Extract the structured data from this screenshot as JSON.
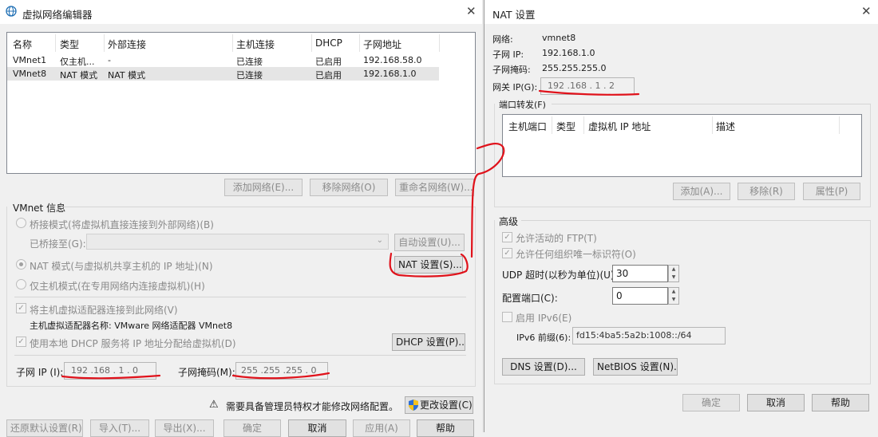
{
  "left": {
    "title": "虚拟网络编辑器",
    "table": {
      "headers": [
        "名称",
        "类型",
        "外部连接",
        "主机连接",
        "DHCP",
        "子网地址"
      ],
      "rows": [
        [
          "VMnet1",
          "仅主机...",
          "-",
          "已连接",
          "已启用",
          "192.168.58.0"
        ],
        [
          "VMnet8",
          "NAT 模式",
          "NAT 模式",
          "已连接",
          "已启用",
          "192.168.1.0"
        ]
      ]
    },
    "add_network": "添加网络(E)...",
    "remove_network": "移除网络(O)",
    "rename_network": "重命名网络(W)...",
    "vmnet_info": "VMnet 信息",
    "bridge_mode": "桥接模式(将虚拟机直接连接到外部网络)(B)",
    "bridged_to": "已桥接至(G):",
    "auto_settings": "自动设置(U)...",
    "nat_mode": "NAT 模式(与虚拟机共享主机的 IP 地址)(N)",
    "nat_settings": "NAT 设置(S)...",
    "host_only_mode": "仅主机模式(在专用网络内连接虚拟机)(H)",
    "connect_adapter": "将主机虚拟适配器连接到此网络(V)",
    "adapter_name": "主机虚拟适配器名称: VMware 网络适配器 VMnet8",
    "use_dhcp": "使用本地 DHCP 服务将 IP 地址分配给虚拟机(D)",
    "dhcp_settings": "DHCP 设置(P)...",
    "subnet_ip_label": "子网 IP (I):",
    "subnet_ip": "192 .168 . 1 . 0",
    "subnet_mask_label": "子网掩码(M):",
    "subnet_mask": "255 .255 .255 . 0",
    "admin_notice": "需要具备管理员特权才能修改网络配置。",
    "change_settings": "更改设置(C)",
    "restore_defaults": "还原默认设置(R)",
    "import": "导入(T)...",
    "export": "导出(X)...",
    "ok": "确定",
    "cancel": "取消",
    "apply": "应用(A)",
    "help": "帮助"
  },
  "right": {
    "title": "NAT 设置",
    "network_label": "网络:",
    "network_value": "vmnet8",
    "subnet_ip_label": "子网 IP:",
    "subnet_ip_value": "192.168.1.0",
    "subnet_mask_label": "子网掩码:",
    "subnet_mask_value": "255.255.255.0",
    "gateway_label": "网关 IP(G):",
    "gateway_value": "192 .168 . 1 . 2",
    "port_forwarding": "端口转发(F)",
    "pf_headers": [
      "主机端口",
      "类型",
      "虚拟机 IP 地址",
      "描述"
    ],
    "add": "添加(A)...",
    "remove": "移除(R)",
    "properties": "属性(P)",
    "advanced": "高级",
    "allow_ftp": "允许活动的 FTP(T)",
    "allow_uuid": "允许任何组织唯一标识符(O)",
    "udp_timeout_label": "UDP 超时(以秒为单位)(U):",
    "udp_timeout": "30",
    "config_port_label": "配置端口(C):",
    "config_port": "0",
    "enable_ipv6": "启用 IPv6(E)",
    "ipv6_prefix_label": "IPv6 前缀(6):",
    "ipv6_prefix": "fd15:4ba5:5a2b:1008::/64",
    "dns_settings": "DNS 设置(D)...",
    "netbios_settings": "NetBIOS 设置(N)...",
    "ok": "确定",
    "cancel": "取消",
    "help": "帮助"
  },
  "colors": {
    "annotation_red": "#e0121b",
    "focus_blue": "#0078d7"
  }
}
